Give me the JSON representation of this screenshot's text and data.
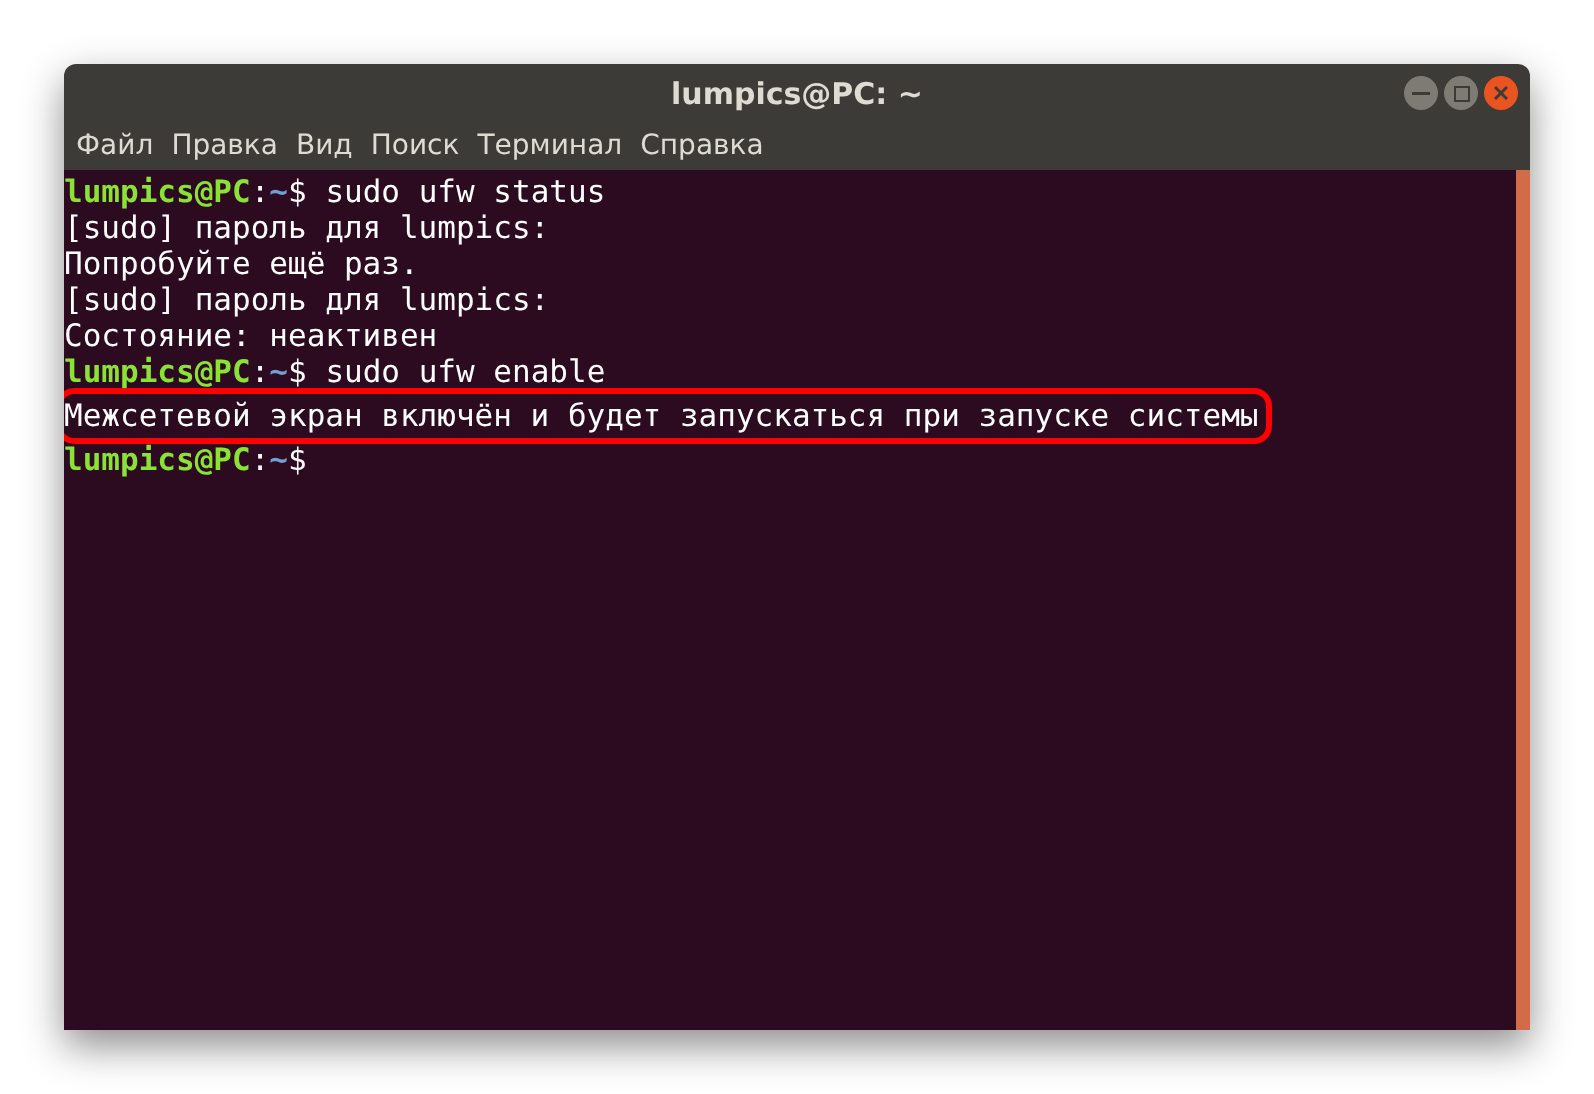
{
  "window": {
    "title": "lumpics@PC: ~"
  },
  "menu": [
    "Файл",
    "Правка",
    "Вид",
    "Поиск",
    "Терминал",
    "Справка"
  ],
  "lines": [
    {
      "kind": "prompt",
      "user": "lumpics@PC",
      "separator": ":",
      "path": "~",
      "symbol": "$",
      "command": " sudo ufw status",
      "highlighted": false
    },
    {
      "kind": "output",
      "text": "[sudo] пароль для lumpics:",
      "highlighted": false
    },
    {
      "kind": "output",
      "text": "Попробуйте ещё раз.",
      "highlighted": false
    },
    {
      "kind": "output",
      "text": "[sudo] пароль для lumpics:",
      "highlighted": false
    },
    {
      "kind": "output",
      "text": "Состояние: неактивен",
      "highlighted": false
    },
    {
      "kind": "prompt",
      "user": "lumpics@PC",
      "separator": ":",
      "path": "~",
      "symbol": "$",
      "command": " sudo ufw enable",
      "highlighted": false
    },
    {
      "kind": "output",
      "text": "Межсетевой экран включён и будет запускаться при запуске системы",
      "highlighted": true
    },
    {
      "kind": "prompt",
      "user": "lumpics@PC",
      "separator": ":",
      "path": "~",
      "symbol": "$",
      "highlighted": false
    }
  ]
}
